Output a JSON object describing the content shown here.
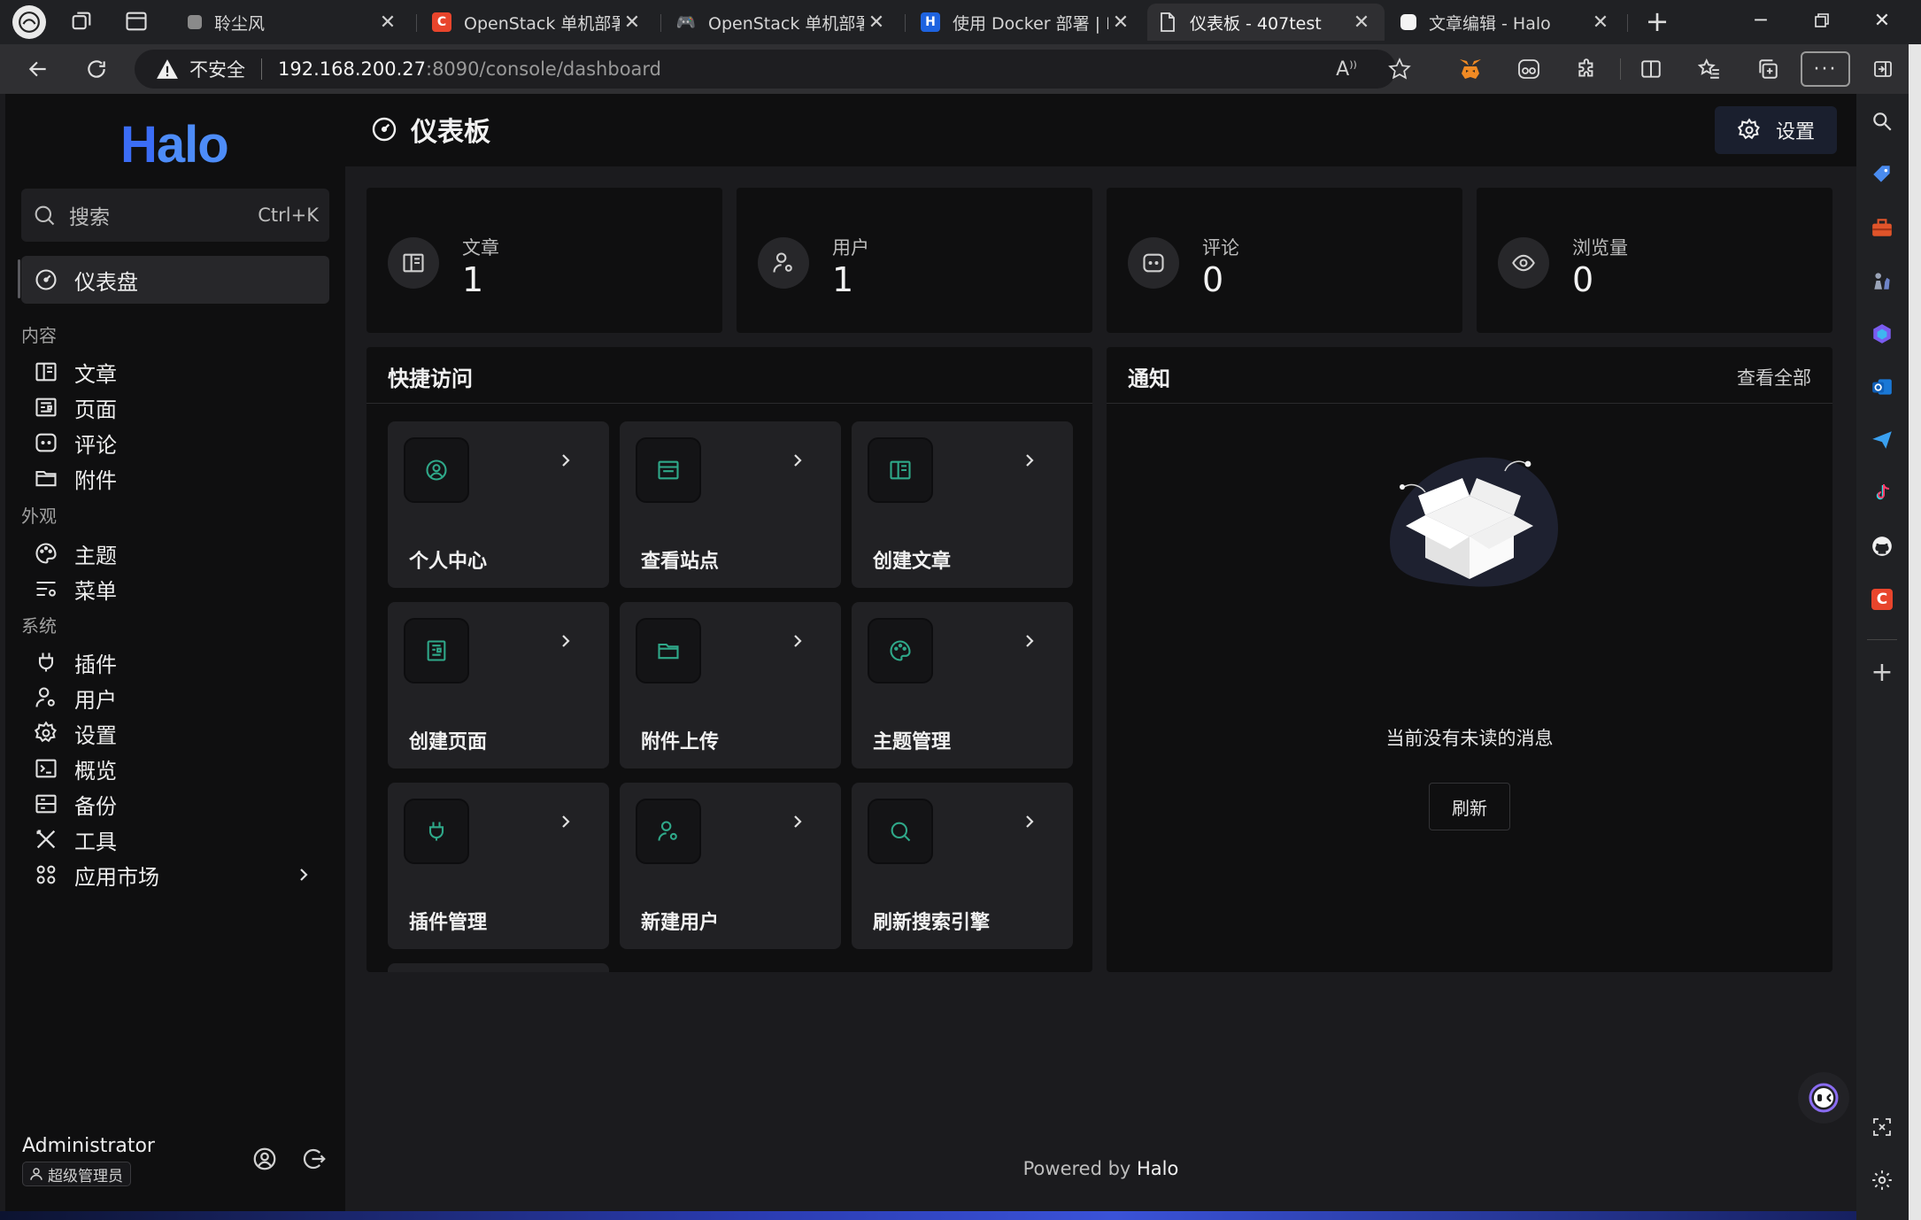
{
  "browser": {
    "tabs": [
      {
        "label": "聆尘风",
        "favicon": "gray-dot-icon",
        "active": false
      },
      {
        "label": "OpenStack 单机部署 -",
        "favicon": "csdn-c-icon",
        "active": false
      },
      {
        "label": "OpenStack 单机部署 -",
        "favicon": "gamepad-icon",
        "active": false
      },
      {
        "label": "使用 Docker 部署 | Ha",
        "favicon": "halo-h-icon",
        "active": false
      },
      {
        "label": "仪表板 - 407test",
        "favicon": "page-icon",
        "active": true
      },
      {
        "label": "文章编辑 - Halo",
        "favicon": "white-square-icon",
        "active": false
      }
    ],
    "security_label": "不安全",
    "url_host": "192.168.200.27",
    "url_rest": ":8090/console/dashboard"
  },
  "sidebar": {
    "logo_first": "H",
    "logo_rest": "alo",
    "search_placeholder": "搜索",
    "search_shortcut": "Ctrl+K",
    "dashboard": "仪表盘",
    "groups": {
      "content": "内容",
      "appearance": "外观",
      "system": "系统"
    },
    "items": {
      "posts": "文章",
      "pages": "页面",
      "comments": "评论",
      "attachments": "附件",
      "themes": "主题",
      "menus": "菜单",
      "plugins": "插件",
      "users": "用户",
      "settings": "设置",
      "overview": "概览",
      "backup": "备份",
      "tools": "工具",
      "app_market": "应用市场"
    },
    "user": {
      "name": "Administrator",
      "role": "超级管理员"
    }
  },
  "header": {
    "title": "仪表板",
    "settings_label": "设置"
  },
  "stats": [
    {
      "label": "文章",
      "value": "1",
      "icon": "book-icon"
    },
    {
      "label": "用户",
      "value": "1",
      "icon": "user-gear-icon"
    },
    {
      "label": "评论",
      "value": "0",
      "icon": "comment-icon"
    },
    {
      "label": "浏览量",
      "value": "0",
      "icon": "eye-icon"
    }
  ],
  "quick_access": {
    "title": "快捷访问",
    "items": [
      {
        "label": "个人中心",
        "icon": "user-circle-icon"
      },
      {
        "label": "查看站点",
        "icon": "window-icon"
      },
      {
        "label": "创建文章",
        "icon": "book-icon"
      },
      {
        "label": "创建页面",
        "icon": "page-icon"
      },
      {
        "label": "附件上传",
        "icon": "folder-icon"
      },
      {
        "label": "主题管理",
        "icon": "palette-icon"
      },
      {
        "label": "插件管理",
        "icon": "plug-icon"
      },
      {
        "label": "新建用户",
        "icon": "user-gear-icon"
      },
      {
        "label": "刷新搜索引擎",
        "icon": "search-icon"
      }
    ]
  },
  "notifications": {
    "title": "通知",
    "view_all": "查看全部",
    "empty_text": "当前没有未读的消息",
    "refresh_label": "刷新"
  },
  "footer": {
    "prefix": "Powered by ",
    "brand": "Halo"
  },
  "colors": {
    "accent_green": "#2fa889",
    "halo_blue": "#4d8cf8",
    "panel_bg": "#0f0f10",
    "page_bg": "#1b1b1e"
  }
}
